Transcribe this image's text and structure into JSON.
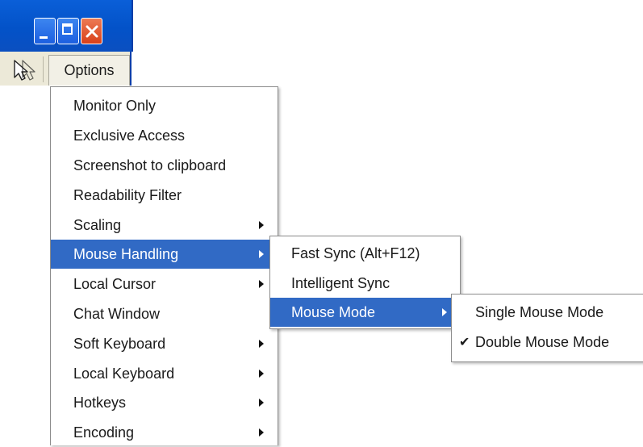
{
  "window": {
    "controls": [
      {
        "name": "minimize-button",
        "icon": "minimize-icon"
      },
      {
        "name": "maximize-button",
        "icon": "maximize-icon"
      },
      {
        "name": "close-button",
        "icon": "close-icon"
      }
    ]
  },
  "toolbar": {
    "cursor_icon": "mouse-pointer-icon",
    "options_label": "Options"
  },
  "main_menu": {
    "items": [
      {
        "label": "Monitor Only",
        "submenu": false
      },
      {
        "label": "Exclusive Access",
        "submenu": false
      },
      {
        "label": "Screenshot to clipboard",
        "submenu": false
      },
      {
        "label": "Readability Filter",
        "submenu": false
      },
      {
        "label": "Scaling",
        "submenu": true
      },
      {
        "label": "Mouse Handling",
        "submenu": true,
        "highlighted": true
      },
      {
        "label": "Local Cursor",
        "submenu": true
      },
      {
        "label": "Chat Window",
        "submenu": false
      },
      {
        "label": "Soft Keyboard",
        "submenu": true
      },
      {
        "label": "Local Keyboard",
        "submenu": true
      },
      {
        "label": "Hotkeys",
        "submenu": true
      },
      {
        "label": "Encoding",
        "submenu": true
      }
    ]
  },
  "mouse_handling_menu": {
    "items": [
      {
        "label": "Fast Sync (Alt+F12)",
        "submenu": false
      },
      {
        "label": "Intelligent Sync",
        "submenu": false
      },
      {
        "label": "Mouse Mode",
        "submenu": true,
        "highlighted": true
      }
    ]
  },
  "mouse_mode_menu": {
    "items": [
      {
        "label": "Single Mouse Mode",
        "checked": false
      },
      {
        "label": "Double Mouse Mode",
        "checked": true
      }
    ],
    "check_glyph": "✔"
  },
  "colors": {
    "highlight": "#316ac5",
    "titlebar": "#0352c8",
    "menubar": "#ece9d8"
  }
}
